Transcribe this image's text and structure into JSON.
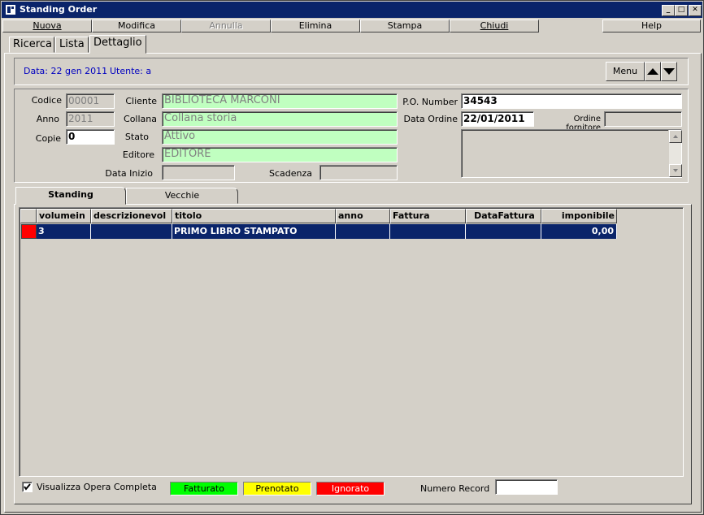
{
  "window": {
    "title": "Standing Order",
    "min_glyph": "_",
    "max_glyph": "□",
    "close_glyph": "✕"
  },
  "toolbar": {
    "nuova": "Nuova",
    "modifica": "Modifica",
    "annulla": "Annulla",
    "elimina": "Elimina",
    "stampa": "Stampa",
    "chiudi": "Chiudi",
    "help": "Help"
  },
  "top_tabs": [
    "Ricerca",
    "Lista",
    "Dettaglio"
  ],
  "info_bar": {
    "data": "Data: 22 gen 2011",
    "utente": "Utente: a",
    "menu_label": "Menu"
  },
  "form": {
    "codice_label": "Codice",
    "codice": "00001",
    "anno_label": "Anno",
    "anno": "2011",
    "copie_label": "Copie",
    "copie": "0",
    "cliente_label": "Cliente",
    "cliente": "BIBLIOTECA MARCONI",
    "collana_label": "Collana",
    "collana": "Collana storia",
    "stato_label": "Stato",
    "stato": "Attivo",
    "editore_label": "Editore",
    "editore": "EDITORE",
    "data_inizio_label": "Data Inizio",
    "data_inizio": "",
    "scadenza_label": "Scadenza",
    "scadenza": "",
    "po_number_label": "P.O. Number",
    "po_number": "34543",
    "data_ordine_label": "Data Ordine",
    "data_ordine": "22/01/2011",
    "ordine_fornitore_label": "Ordine fornitore",
    "ordine_fornitore": "",
    "note": ""
  },
  "sub_tabs": [
    "Standing",
    "Vecchie"
  ],
  "grid": {
    "columns": [
      "volumein",
      "descrizionevol",
      "titolo",
      "anno",
      "Fattura",
      "DataFattura",
      "imponibile"
    ],
    "rows": [
      {
        "volume": "3",
        "descrizione": "",
        "titolo": "PRIMO LIBRO STAMPATO",
        "anno": "",
        "fattura": "",
        "data_fattura": "",
        "imponibile": "0,00"
      }
    ]
  },
  "footer": {
    "visualizza_label": "Visualizza Opera Completa",
    "visualizza_checked": true,
    "fatturato": "Fatturato",
    "prenotato": "Prenotato",
    "ignorato": "Ignorato",
    "numero_record_label": "Numero Record",
    "numero_record": ""
  },
  "colors": {
    "titlebar": "#0a246a",
    "fatturato": "#00ff00",
    "prenotato": "#ffff00",
    "ignorato": "#ff0000",
    "row_marker": "#ff0000",
    "green_field": "#c0ffc0"
  }
}
